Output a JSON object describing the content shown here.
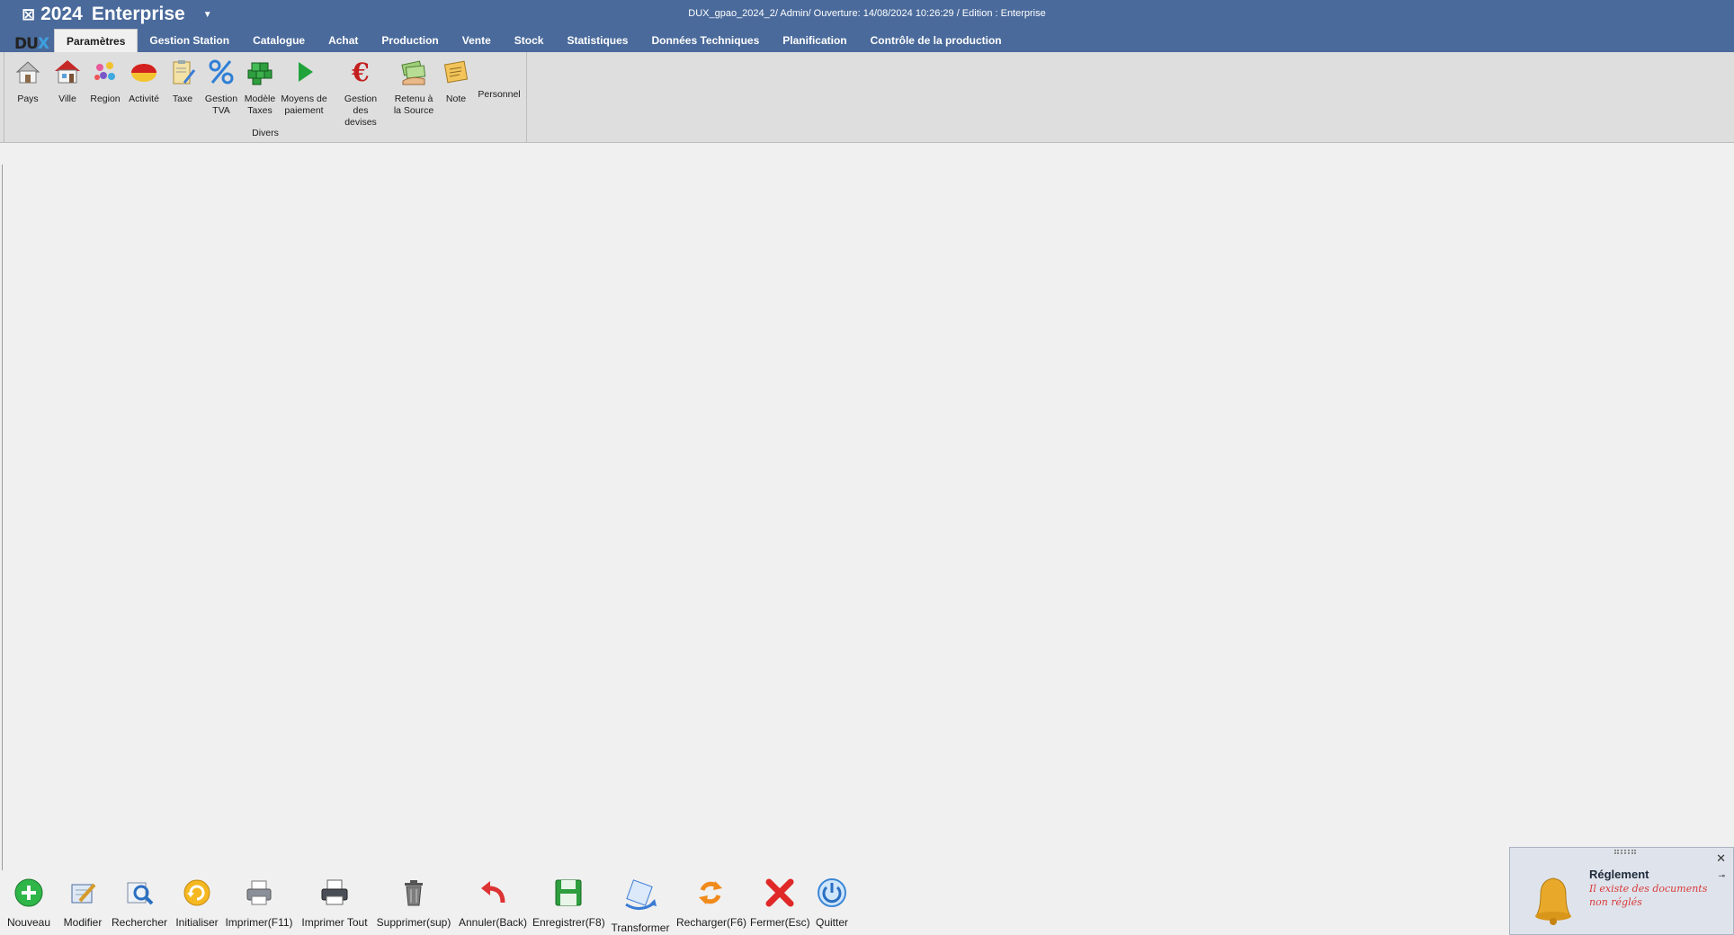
{
  "app": {
    "year": "2024",
    "edition": "Enterprise",
    "window_info": "DUX_gpao_2024_2/ Admin/ Ouverture: 14/08/2024 10:26:29 / Edition : Enterprise",
    "logo_left": "DU",
    "logo_right": "X"
  },
  "tabs": [
    {
      "label": "Paramètres",
      "active": true
    },
    {
      "label": "Gestion Station"
    },
    {
      "label": "Catalogue"
    },
    {
      "label": "Achat"
    },
    {
      "label": "Production"
    },
    {
      "label": "Vente"
    },
    {
      "label": "Stock"
    },
    {
      "label": "Statistiques"
    },
    {
      "label": "Données Techniques"
    },
    {
      "label": "Planification"
    },
    {
      "label": "Contrôle de la production"
    }
  ],
  "ribbon": {
    "group_caption": "Divers",
    "buttons": [
      {
        "label": "Pays",
        "icon": "house-icon"
      },
      {
        "label": "Ville",
        "icon": "red-roof-house-icon"
      },
      {
        "label": "Region",
        "icon": "molecules-icon"
      },
      {
        "label": "Activité",
        "icon": "red-yellow-pie-icon"
      },
      {
        "label": "Taxe",
        "icon": "clipboard-pencil-icon"
      },
      {
        "label": "Gestion\nTVA",
        "icon": "percent-icon"
      },
      {
        "label": "Modèle\nTaxes",
        "icon": "green-cubes-icon"
      },
      {
        "label": "Moyens de\npaiement",
        "icon": "green-play-icon"
      },
      {
        "label": "Gestion des\ndevises",
        "icon": "euro-icon"
      },
      {
        "label": "Retenu à\nla Source",
        "icon": "money-hand-icon"
      },
      {
        "label": "Note",
        "icon": "note-icon"
      },
      {
        "label": "Personnel",
        "icon": "personnel-icon"
      }
    ]
  },
  "bottom_toolbar": [
    {
      "label": "Nouveau"
    },
    {
      "label": "Modifier"
    },
    {
      "label": "Rechercher"
    },
    {
      "label": "Initialiser"
    },
    {
      "label": "Imprimer(F11)"
    },
    {
      "label": "Imprimer Tout"
    },
    {
      "label": "Supprimer(sup)"
    },
    {
      "label": "Annuler(Back)"
    },
    {
      "label": "Enregistrer(F8)"
    },
    {
      "label": "Transformer"
    },
    {
      "label": "Recharger(F6)"
    },
    {
      "label": "Fermer(Esc)"
    },
    {
      "label": "Quitter"
    }
  ],
  "notification": {
    "title": "Réglement",
    "message": "Il existe des documents non réglés"
  },
  "colors": {
    "title_bar": "#4a6a9b",
    "ribbon_bg": "#dedede",
    "workspace_bg": "#f0f0f0",
    "notification_text": "#d83a3a"
  }
}
